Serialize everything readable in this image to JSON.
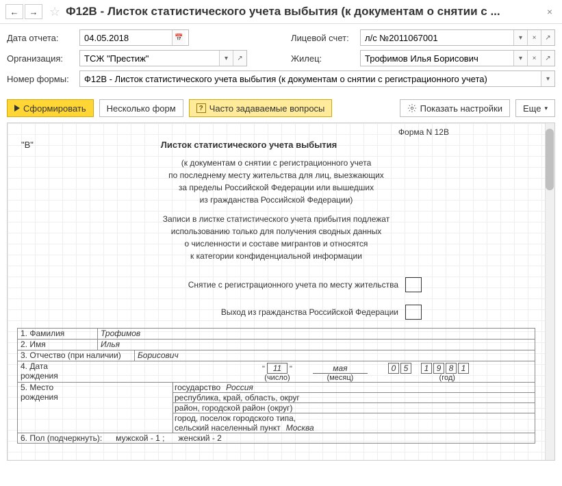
{
  "header": {
    "title": "Ф12В - Листок статистического учета выбытия (к документам о снятии с ..."
  },
  "form": {
    "date_label": "Дата отчета:",
    "date_value": "04.05.2018",
    "account_label": "Лицевой счет:",
    "account_value": "л/с №2011067001",
    "org_label": "Организация:",
    "org_value": "ТСЖ \"Престиж\"",
    "tenant_label": "Жилец:",
    "tenant_value": "Трофимов Илья Борисович",
    "formnum_label": "Номер формы:",
    "formnum_value": "Ф12В - Листок статистического учета выбытия (к документам о снятии с регистрационного учета)"
  },
  "toolbar": {
    "generate": "Сформировать",
    "multiple": "Несколько форм",
    "faq": "Часто задаваемые вопросы",
    "settings": "Показать настройки",
    "more": "Еще"
  },
  "doc": {
    "form_n": "Форма N 12В",
    "v": "\"В\"",
    "title": "Листок статистического учета выбытия",
    "sub1": "(к документам о снятии с регистрационного учета",
    "sub2": "по последнему месту жительства для лиц, выезжающих",
    "sub3": "за пределы Российской Федерации или вышедших",
    "sub4": "из гражданства Российской Федерации)",
    "note1": "Записи в листке статистического учета прибытия подлежат",
    "note2": "использованию только для получения сводных данных",
    "note3": "о численности и составе мигрантов и относятся",
    "note4": "к категории конфиденциальной информации",
    "check1": "Снятие с регистрационного учета по месту жительства",
    "check2": "Выход из гражданства Российской Федерации",
    "f1_label": "1. Фамилия",
    "f1_value": "Трофимов",
    "f2_label": "2. Имя",
    "f2_value": "Илья",
    "f3_label": "3. Отчество (при наличии)",
    "f3_value": "Борисович",
    "f4_label": "4. Дата",
    "f4_label2": "рождения",
    "birth_day": "11",
    "birth_day_l": "(число)",
    "birth_month": "мая",
    "birth_month_l": "(месяц)",
    "birth_y1": "0",
    "birth_y2": "5",
    "birth_y3": "1",
    "birth_y4": "9",
    "birth_y5": "8",
    "birth_y6": "1",
    "birth_year_l": "(год)",
    "f5_label": "5. Место",
    "f5_label2": "рождения",
    "p1k": "государство",
    "p1v": "Россия",
    "p2k": "республика, край, область, округ",
    "p3k": "район, городской район (округ)",
    "p4k": "город, поселок городского типа,",
    "p5k": "сельский населенный пункт",
    "p5v": "Москва",
    "f6": "6. Пол (подчеркнуть):      мужской - 1 ;      женский - 2"
  }
}
